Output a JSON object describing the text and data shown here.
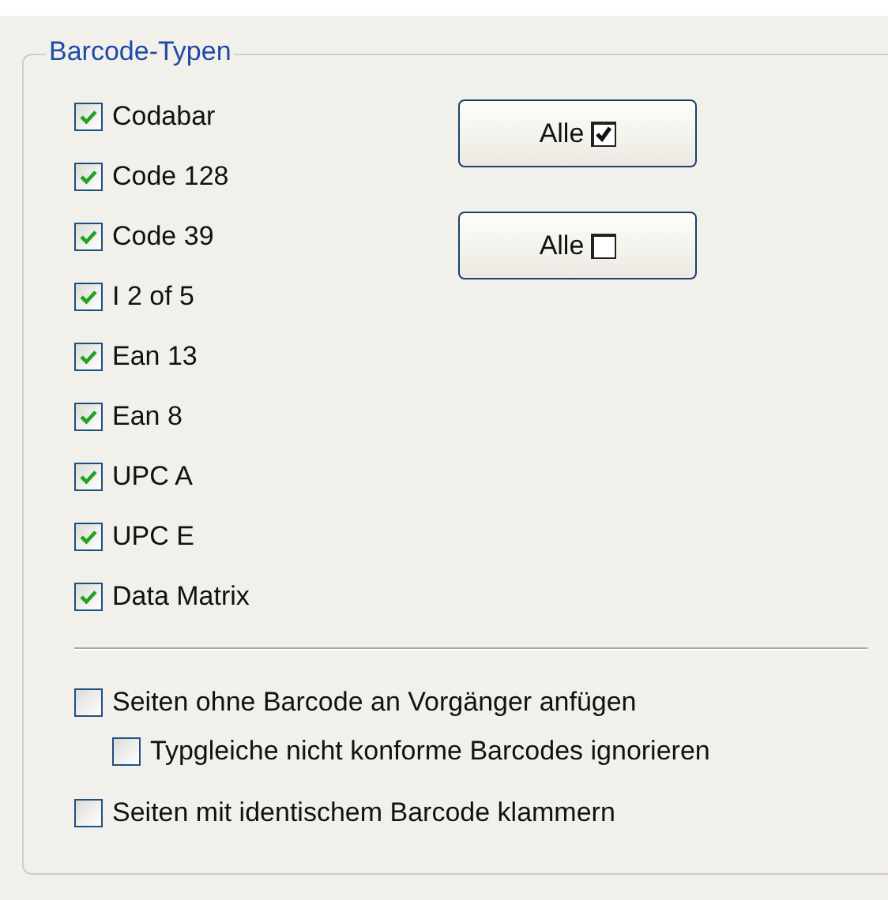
{
  "group": {
    "title": "Barcode-Typen",
    "barcode_types": [
      {
        "label": "Codabar",
        "checked": true
      },
      {
        "label": "Code 128",
        "checked": true
      },
      {
        "label": "Code 39",
        "checked": true
      },
      {
        "label": "I 2 of 5",
        "checked": true
      },
      {
        "label": "Ean 13",
        "checked": true
      },
      {
        "label": "Ean 8",
        "checked": true
      },
      {
        "label": "UPC A",
        "checked": true
      },
      {
        "label": "UPC E",
        "checked": true
      },
      {
        "label": "Data Matrix",
        "checked": true
      }
    ],
    "buttons": [
      {
        "label": "Alle",
        "checked": true
      },
      {
        "label": "Alle",
        "checked": false
      }
    ],
    "options": [
      {
        "label": "Seiten ohne Barcode an Vorgänger anfügen",
        "checked": false,
        "children": [
          {
            "label": "Typgleiche nicht konforme Barcodes ignorieren",
            "checked": false
          }
        ]
      },
      {
        "label": "Seiten mit identischem Barcode klammern",
        "checked": false
      }
    ]
  }
}
